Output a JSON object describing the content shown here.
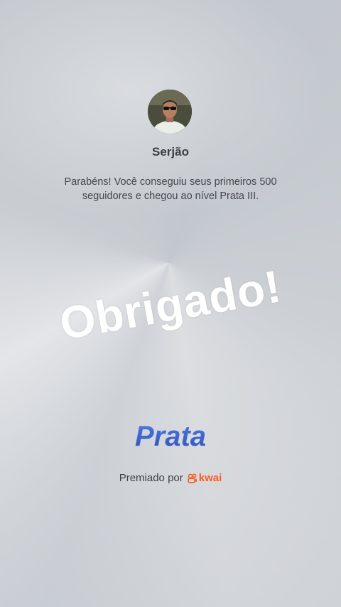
{
  "user": {
    "name": "Serjão"
  },
  "message": "Parabéns! Você conseguiu seus primeiros 500 seguidores e chegou ao nível Prata III.",
  "thanks_text": "Obrigado!",
  "level": {
    "name": "Prata",
    "color": "#3d63c9"
  },
  "award": {
    "prefix": "Premiado por",
    "brand": "kwai",
    "brand_color": "#ff5a1f",
    "brand_icon": "kwai-logo-icon"
  }
}
